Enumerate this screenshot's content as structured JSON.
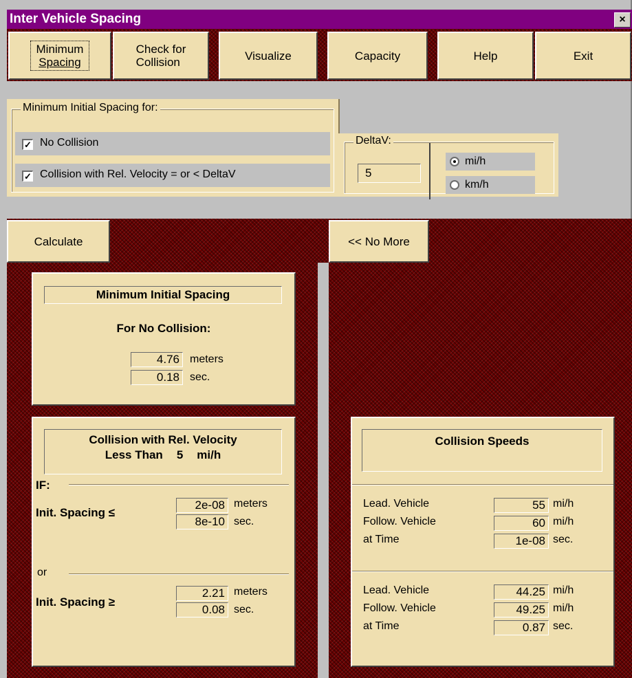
{
  "window": {
    "title": "Inter Vehicle Spacing",
    "close_label": "×"
  },
  "toolbar": {
    "min_spacing_line1": "Minimum",
    "min_spacing_line2": "Spacing",
    "check_line1": "Check for",
    "check_line2": "Collision",
    "visualize": "Visualize",
    "capacity": "Capacity",
    "help": "Help",
    "exit": "Exit"
  },
  "options": {
    "group_title": "Minimum Initial Spacing for:",
    "no_collision_label": "No Collision",
    "no_collision_checked": true,
    "rel_velocity_label": "Collision with Rel. Velocity = or < DeltaV",
    "rel_velocity_checked": true,
    "deltav_title": "DeltaV:",
    "deltav_value": "5",
    "unit_mih": "mi/h",
    "unit_kmh": "km/h",
    "selected_unit": "mi/h"
  },
  "actions": {
    "calculate": "Calculate",
    "no_more": "<< No More"
  },
  "min_spacing": {
    "header": "Minimum Initial Spacing",
    "subheader": "For No Collision:",
    "meters_value": "4.76",
    "meters_unit": "meters",
    "sec_value": "0.18",
    "sec_unit": "sec."
  },
  "collision": {
    "header_line1": "Collision with Rel. Velocity",
    "header_less": "Less Than",
    "header_value": "5",
    "header_unit": "mi/h",
    "if_label": "IF:",
    "or_label": "or",
    "le_label": "Init. Spacing  ≤",
    "le_meters": "2e-08",
    "le_sec": "8e-10",
    "ge_label": "Init. Spacing  ≥",
    "ge_meters": "2.21",
    "ge_sec": "0.08",
    "meters_unit": "meters",
    "sec_unit": "sec."
  },
  "speeds": {
    "header": "Collision Speeds",
    "lead_label": "Lead. Vehicle",
    "follow_label": "Follow. Vehicle",
    "time_label": "at Time",
    "unit_mih": "mi/h",
    "unit_sec": "sec.",
    "set1": {
      "lead": "55",
      "follow": "60",
      "time": "1e-08"
    },
    "set2": {
      "lead": "44.25",
      "follow": "49.25",
      "time": "0.87"
    }
  },
  "colors": {
    "title_bar": "#800080",
    "panel": "#efdfb0",
    "backdrop": "#6b0000"
  }
}
